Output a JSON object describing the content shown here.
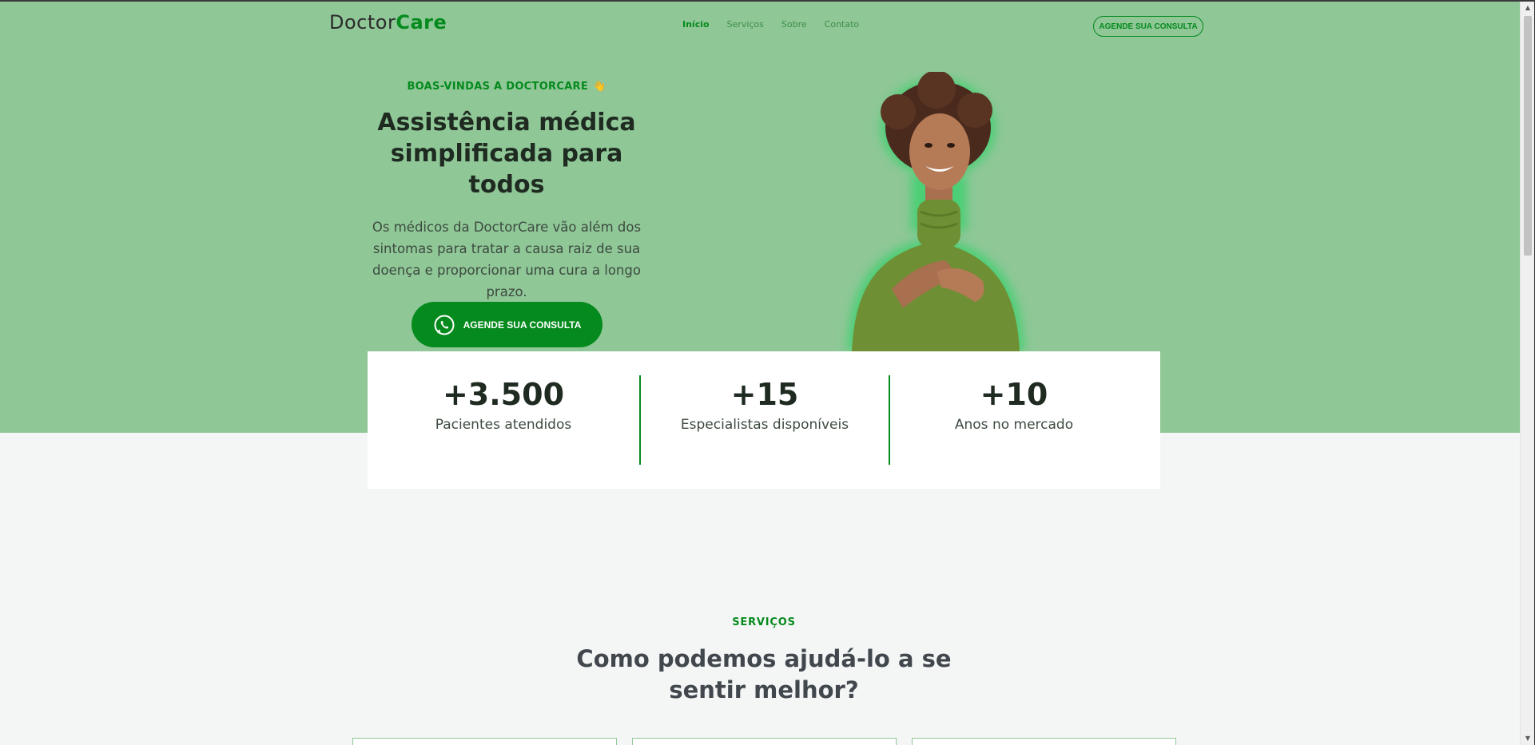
{
  "brand": {
    "logo_part1": "Doctor",
    "logo_part2": "Care",
    "accent_color": "#058a1d",
    "hero_bg_color": "#8fc797"
  },
  "nav": {
    "items": [
      {
        "label": "Início",
        "active": true
      },
      {
        "label": "Serviços",
        "active": false
      },
      {
        "label": "Sobre",
        "active": false
      },
      {
        "label": "Contato",
        "active": false
      }
    ],
    "cta_label": "AGENDE SUA CONSULTA"
  },
  "hero": {
    "eyebrow": "BOAS-VINDAS A DOCTORCARE",
    "eyebrow_emoji": "👋",
    "title": "Assistência médica simplificada para todos",
    "description": "Os médicos da DoctorCare vão além dos sintomas para tratar a causa raiz de sua doença e proporcionar uma cura a longo prazo.",
    "cta_label": "AGENDE SUA CONSULTA",
    "cta_icon": "whatsapp-icon"
  },
  "stats": [
    {
      "value": "+3.500",
      "label": "Pacientes atendidos"
    },
    {
      "value": "+15",
      "label": "Especialistas disponíveis"
    },
    {
      "value": "+10",
      "label": "Anos no mercado"
    }
  ],
  "services": {
    "eyebrow": "SERVIÇOS",
    "title": "Como podemos ajudá-lo a se sentir melhor?"
  },
  "scrollbar": {
    "up_glyph": "▲",
    "down_glyph": "▼"
  }
}
